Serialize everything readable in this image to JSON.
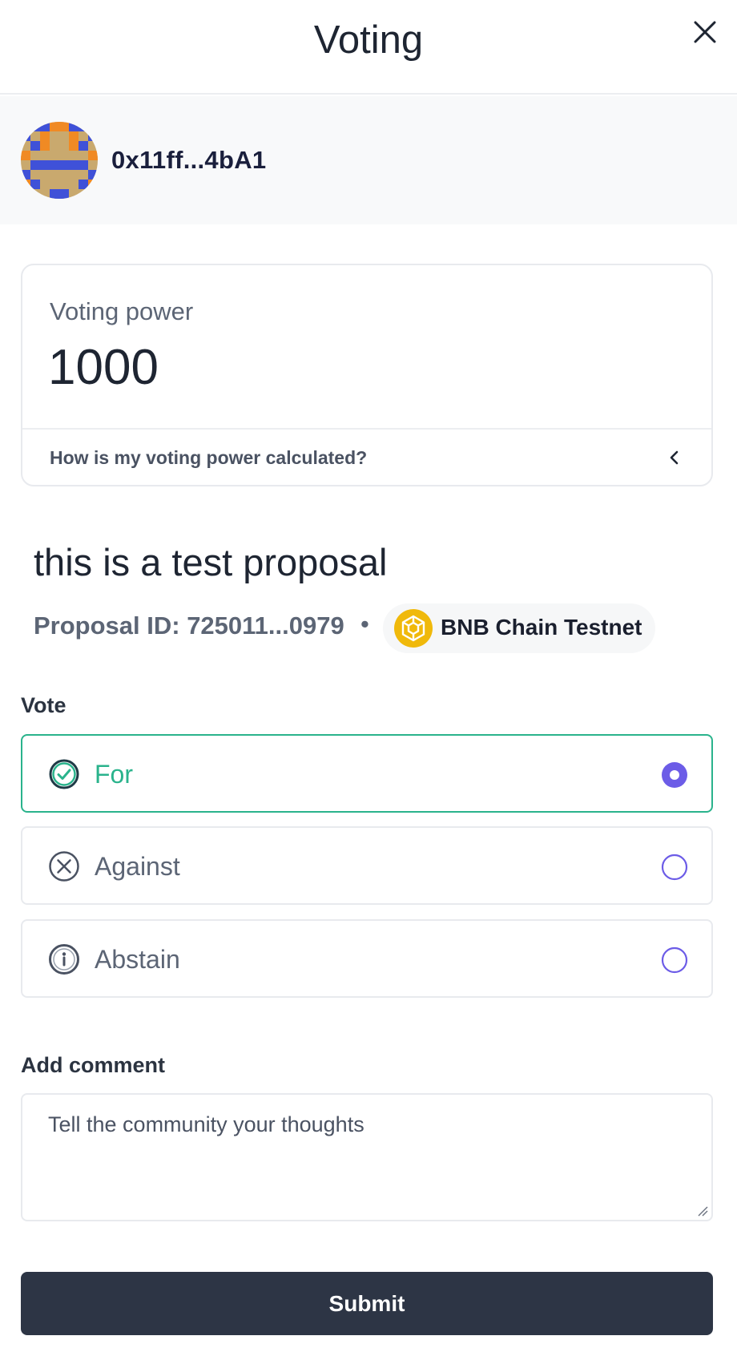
{
  "header": {
    "title": "Voting"
  },
  "account": {
    "address": "0x11ff...4bA1"
  },
  "voting_power": {
    "label": "Voting power",
    "value": "1000",
    "help_text": "How is my voting power calculated?"
  },
  "proposal": {
    "title": "this is a test proposal",
    "id_text": "Proposal ID: 725011...0979",
    "separator": "•",
    "chain": "BNB Chain Testnet"
  },
  "vote": {
    "label": "Vote",
    "options": [
      {
        "label": "For",
        "selected": true
      },
      {
        "label": "Against",
        "selected": false
      },
      {
        "label": "Abstain",
        "selected": false
      }
    ]
  },
  "comment": {
    "label": "Add comment",
    "placeholder": "Tell the community your thoughts"
  },
  "submit": {
    "label": "Submit"
  },
  "colors": {
    "accent_green": "#2ab38c",
    "radio_purple": "#6c5ce7",
    "button_dark": "#2d3545",
    "bnb_yellow": "#f0b90b"
  },
  "icons": {
    "close": "close-icon",
    "chevron": "chevron-left-icon",
    "for": "check-circle-icon",
    "against": "x-circle-icon",
    "abstain": "info-circle-icon",
    "chain": "bnb-chain-icon"
  }
}
